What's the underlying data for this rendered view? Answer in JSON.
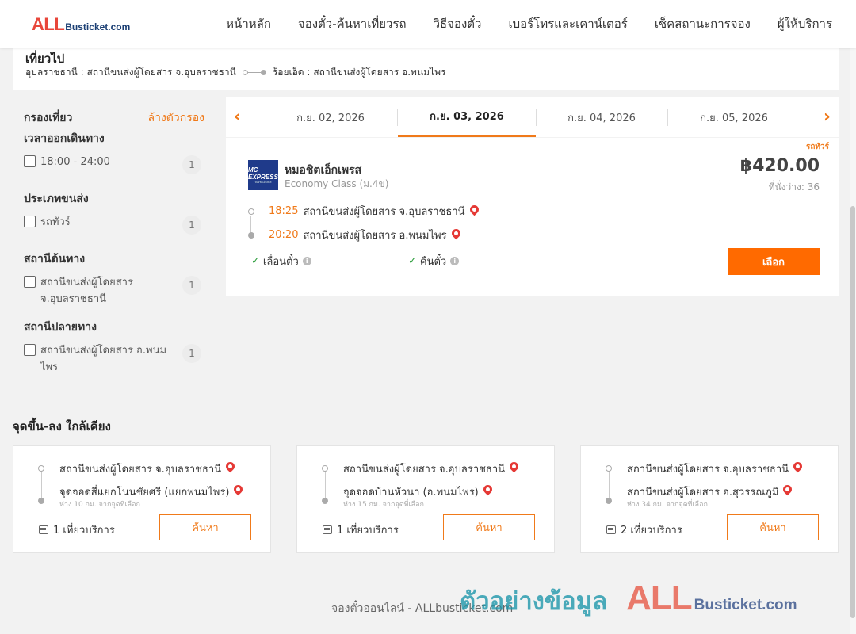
{
  "header": {
    "logo_all": "ALL",
    "logo_rest": "Busticket.com",
    "nav": [
      "หน้าหลัก",
      "จองตั๋ว-ค้นหาเที่ยวรถ",
      "วิธีจองตั๋ว",
      "เบอร์โทรและเคาน์เตอร์",
      "เช็คสถานะการจอง",
      "ผู้ให้บริการ"
    ]
  },
  "route": {
    "title": "เที่ยวไป",
    "from": "อุบลราชธานี : สถานีขนส่งผู้โดยสาร จ.อุบลราชธานี",
    "to": "ร้อยเอ็ด : สถานีขนส่งผู้โดยสาร อ.พนมไพร"
  },
  "filter": {
    "title": "กรองเที่ยว",
    "clear": "ล้างตัวกรอง",
    "groups": [
      {
        "title": "เวลาออกเดินทาง",
        "option": "18:00 - 24:00",
        "count": "1"
      },
      {
        "title": "ประเภทขนส่ง",
        "option": "รถทัวร์",
        "count": "1"
      },
      {
        "title": "สถานีต้นทาง",
        "option": "สถานีขนส่งผู้โดยสาร จ.อุบลราชธานี",
        "count": "1"
      },
      {
        "title": "สถานีปลายทาง",
        "option": "สถานีขนส่งผู้โดยสาร อ.พนมไพร",
        "count": "1"
      }
    ]
  },
  "dates": {
    "tabs": [
      "ก.ย. 02, 2026",
      "ก.ย. 03, 2026",
      "ก.ย. 04, 2026",
      "ก.ย. 05, 2026"
    ],
    "active_index": 1,
    "prev_icon": "chevron-left-icon",
    "next_icon": "chevron-right-icon"
  },
  "result": {
    "tag": "รถทัวร์",
    "logo_text": "MC EXPRESS",
    "logo_sub": "หมอชิตเอ็กเพรส",
    "operator": "หมอชิตเอ็กเพรส",
    "class": "Economy Class (ม.4ข)",
    "price": "฿420.00",
    "seats": "ที่นั่งว่าง: 36",
    "depart_time": "18:25",
    "depart_station": "สถานีขนส่งผู้โดยสาร จ.อุบลราชธานี",
    "arrive_time": "20:20",
    "arrive_station": "สถานีขนส่งผู้โดยสาร อ.พนมไพร",
    "policy_reschedule": "เลื่อนตั๋ว",
    "policy_refund": "คืนตั๋ว",
    "select_label": "เลือก"
  },
  "nearby": {
    "title": "จุดขึ้น-ลง ใกล้เคียง",
    "cards": [
      {
        "from": "สถานีขนส่งผู้โดยสาร จ.อุบลราชธานี",
        "to": "จุดจอดสี่แยกโนนชัยศรี (แยกพนมไพร)",
        "distance": "ห่าง 10 กม. จากจุดที่เลือก",
        "trips": "1 เที่ยวบริการ",
        "button": "ค้นหา"
      },
      {
        "from": "สถานีขนส่งผู้โดยสาร จ.อุบลราชธานี",
        "to": "จุดจอดบ้านหัวนา (อ.พนมไพร)",
        "distance": "ห่าง 15 กม. จากจุดที่เลือก",
        "trips": "1 เที่ยวบริการ",
        "button": "ค้นหา"
      },
      {
        "from": "สถานีขนส่งผู้โดยสาร จ.อุบลราชธานี",
        "to": "สถานีขนส่งผู้โดยสาร อ.สุวรรณภูมิ",
        "distance": "ห่าง 34 กม. จากจุดที่เลือก",
        "trips": "2 เที่ยวบริการ",
        "button": "ค้นหา"
      }
    ]
  },
  "footer": {
    "text": "จองตั๋วออนไลน์ - ALLbusticket.com"
  },
  "watermark": {
    "thai": "ตัวอย่างข้อมูล",
    "all": "ALL",
    "rest": "Busticket.com"
  },
  "colors": {
    "accent": "#f07a1a",
    "button": "#ff6a00",
    "pin": "#e53935"
  }
}
